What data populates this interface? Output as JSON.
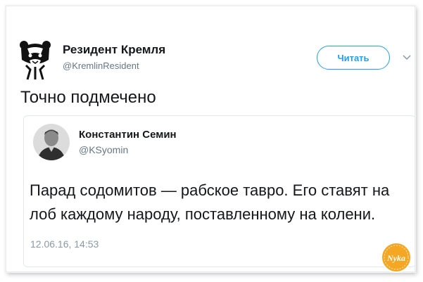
{
  "tweet": {
    "author_name": "Резидент Кремля",
    "author_handle": "@KremlinResident",
    "follow_label": "Читать",
    "text": "Точно подмечено"
  },
  "quoted": {
    "author_name": "Константин Семин",
    "author_handle": "@KSyomin",
    "text": "Парад содомитов — рабское тавро. Его ставят на лоб каждому народу, поставленному на колени.",
    "timestamp": "12.06.16, 14:53"
  },
  "watermark": {
    "text": "Nyka"
  },
  "colors": {
    "accent": "#1da1f2",
    "secondary_text": "#657786",
    "primary_text": "#14171a",
    "watermark": "#f5a623"
  },
  "icons": {
    "caret": "chevron-down-icon",
    "avatar_main": "bear-emblem-icon"
  }
}
